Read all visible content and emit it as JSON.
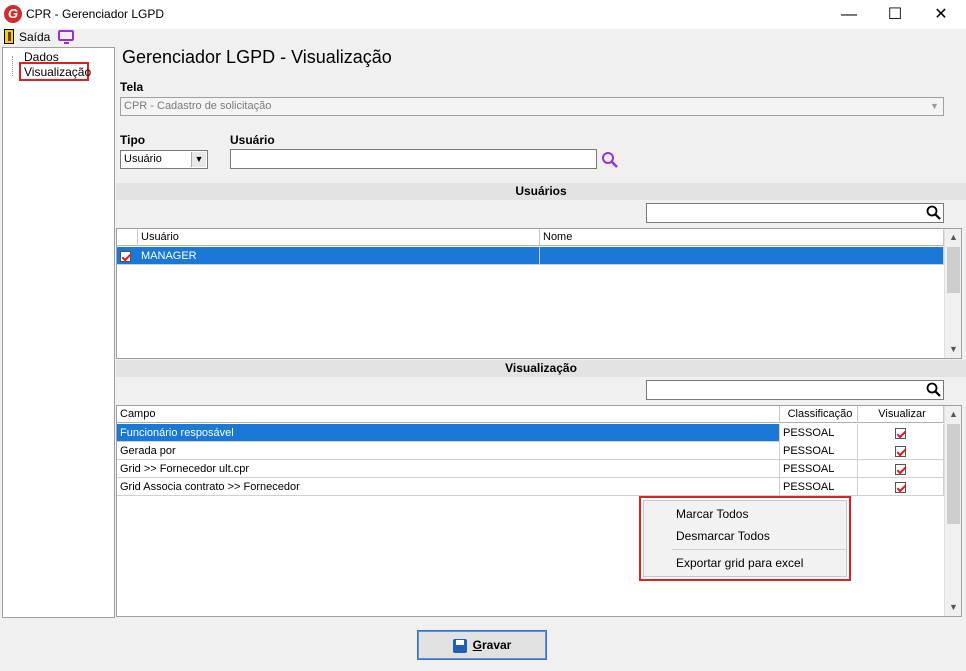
{
  "window": {
    "title": "CPR - Gerenciador LGPD",
    "logo_letter": "G",
    "minimize_glyph": "—",
    "maximize_glyph": "☐",
    "close_glyph": "✕"
  },
  "menu": {
    "exit_label": "Saída"
  },
  "tree": {
    "items": [
      "Dados",
      "Visualização"
    ]
  },
  "page": {
    "title": "Gerenciador LGPD - Visualização"
  },
  "tela": {
    "label": "Tela",
    "value": "CPR - Cadastro de solicitação"
  },
  "tipo": {
    "label": "Tipo",
    "value": "Usuário"
  },
  "usuario": {
    "label": "Usuário",
    "value": ""
  },
  "usuarios_section": {
    "header": "Usuários",
    "columns": [
      "Usuário",
      "Nome"
    ],
    "rows": [
      {
        "usuario": "MANAGER",
        "nome": "",
        "checked": true
      }
    ]
  },
  "visualizacao_section": {
    "header": "Visualização",
    "columns": [
      "Campo",
      "Classificação",
      "Visualizar"
    ],
    "rows": [
      {
        "campo": "Funcionário resposável",
        "classificacao": "PESSOAL",
        "visualizar": true
      },
      {
        "campo": "Gerada por",
        "classificacao": "PESSOAL",
        "visualizar": true
      },
      {
        "campo": "Grid >> Fornecedor ult.cpr",
        "classificacao": "PESSOAL",
        "visualizar": true
      },
      {
        "campo": "Grid Associa contrato >> Fornecedor",
        "classificacao": "PESSOAL",
        "visualizar": true
      }
    ]
  },
  "context_menu": {
    "items": [
      "Marcar Todos",
      "Desmarcar Todos",
      "Exportar grid para excel"
    ]
  },
  "buttons": {
    "save_first": "G",
    "save_rest": "ravar"
  },
  "colors": {
    "selection": "#1a78d7",
    "highlight_border": "#e02020",
    "checkmark": "#e01b1b",
    "search_icon": "#9b2fd6"
  }
}
